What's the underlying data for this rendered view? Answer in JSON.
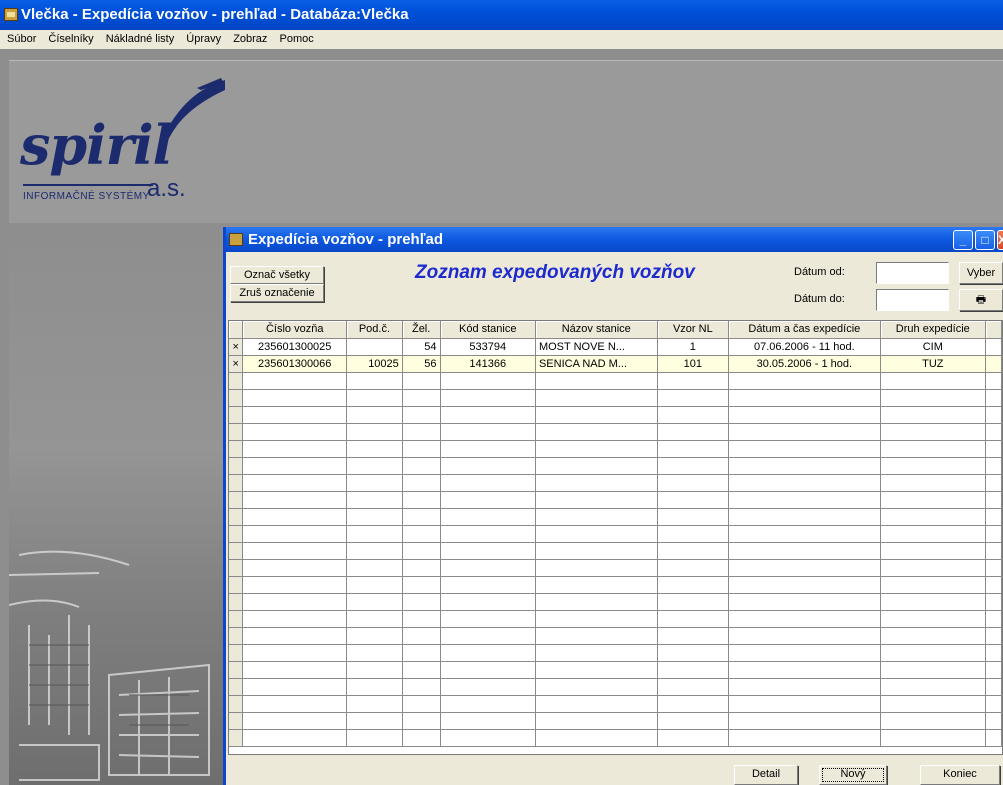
{
  "app": {
    "title": "Vlečka - Expedícia vozňov - prehľad - Databáza:Vlečka"
  },
  "menu": [
    "Súbor",
    "Číselníky",
    "Nákladné listy",
    "Úpravy",
    "Zobraz",
    "Pomoc"
  ],
  "logo": {
    "name": "spiril",
    "sub": "INFORMAČNÉ SYSTÉMY",
    "suffix": "a.s."
  },
  "window": {
    "title": "Expedícia vozňov - prehľad",
    "minimize_icon": "_",
    "maximize_icon": "□",
    "close_icon": "X"
  },
  "toolbar": {
    "select_all": "Označ všetky",
    "clear_selection": "Zruš označenie",
    "heading": "Zoznam expedovaných vozňov",
    "date_from_label": "Dátum od:",
    "date_to_label": "Dátum do:",
    "date_from_value": "",
    "date_to_value": "",
    "choose": "Vyber",
    "print_icon": "🖶"
  },
  "grid": {
    "columns": [
      "Číslo vozňa",
      "Pod.č.",
      "Žel.",
      "Kód stanice",
      "Názov stanice",
      "Vzor NL",
      "Dátum a čas expedície",
      "Druh expedície"
    ],
    "rows": [
      {
        "mark": "×",
        "cislo": "235601300025",
        "pod": "",
        "zel": "54",
        "kod": "533794",
        "nazov": "MOST NOVE N...",
        "vzor": "1",
        "datum": "07.06.2006 - 11 hod.",
        "druh": "CIM"
      },
      {
        "mark": "×",
        "cislo": "235601300066",
        "pod": "10025",
        "zel": "56",
        "kod": "141366",
        "nazov": "SENICA NAD M...",
        "vzor": "101",
        "datum": "30.05.2006 - 1 hod.",
        "druh": "TUZ"
      }
    ]
  },
  "footer": {
    "detail": "Detail",
    "new": "Nový",
    "end": "Koniec"
  }
}
